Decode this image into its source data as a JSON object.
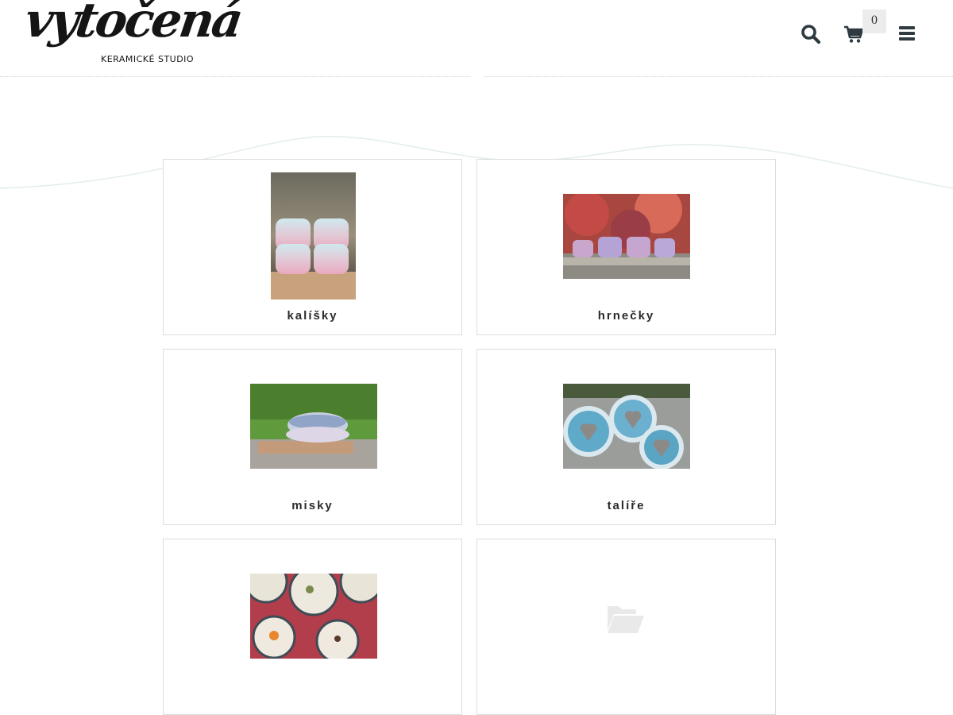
{
  "brand": {
    "logo_text": "vytočená",
    "logo_subtitle": "KERAMICKÉ STUDIO"
  },
  "header": {
    "cart_count": "0",
    "icons": [
      "search-icon",
      "cart-icon",
      "menu-icon"
    ]
  },
  "categories": [
    {
      "label": "kalíšky",
      "image": "stacked pastel cups photo"
    },
    {
      "label": "hrnečky",
      "image": "mugs on stone photo"
    },
    {
      "label": "misky",
      "image": "bowls on grass photo"
    },
    {
      "label": "talíře",
      "image": "blue heart plates photo"
    },
    {
      "label": "",
      "image": "tea bowls with spices photo"
    },
    {
      "label": "",
      "image": "folder-open-icon"
    }
  ],
  "colors": {
    "accent": "#2e3a40",
    "card_border": "#dcdcdc",
    "label": "#2b2b2b"
  }
}
